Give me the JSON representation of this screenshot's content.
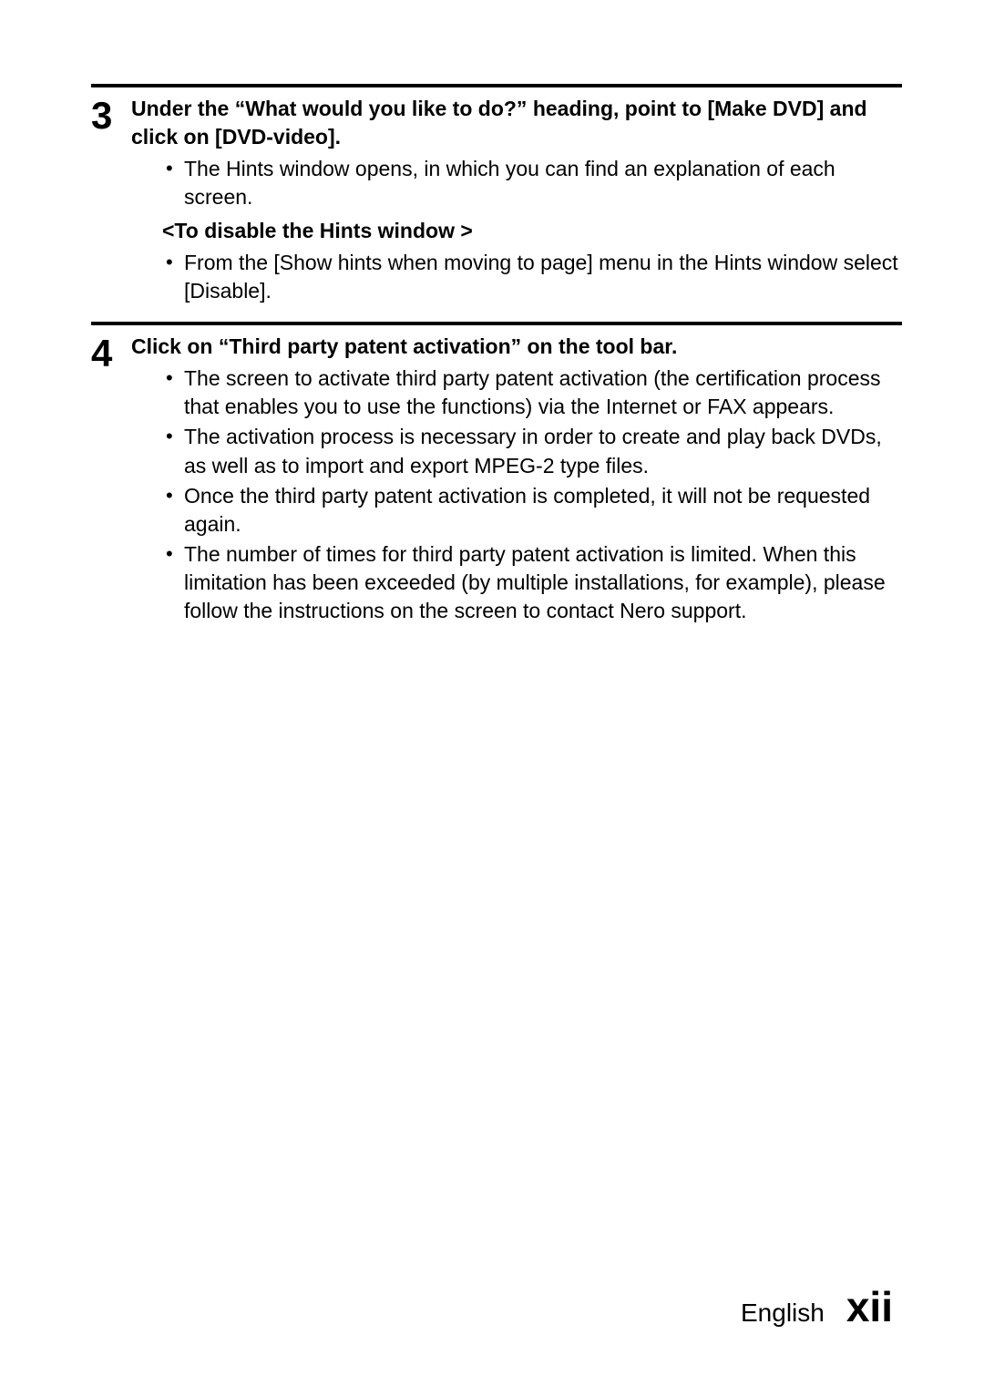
{
  "step3": {
    "number": "3",
    "heading": "Under the “What would you like to do?” heading, point to [Make DVD] and click on [DVD-video].",
    "bullets_a": [
      "The Hints window opens, in which you can find an explanation of each screen."
    ],
    "subhead": "<To disable the Hints window >",
    "bullets_b": [
      "From the [Show hints when moving to page] menu in the Hints window select [Disable]."
    ]
  },
  "step4": {
    "number": "4",
    "heading": "Click on “Third party patent activation” on the tool bar.",
    "bullets": [
      "The screen to activate third party patent activation (the certification process that enables you to use the functions) via the Internet or FAX appears.",
      "The activation process is necessary in order to create and play back DVDs, as well as to import and export MPEG-2 type files.",
      "Once the third party patent activation is completed, it will not be requested again.",
      "The number of times for third party patent activation is limited. When this limitation has been exceeded (by multiple installations, for example), please follow the instructions on the screen to contact Nero support."
    ]
  },
  "footer": {
    "language": "English",
    "page": "xii"
  }
}
